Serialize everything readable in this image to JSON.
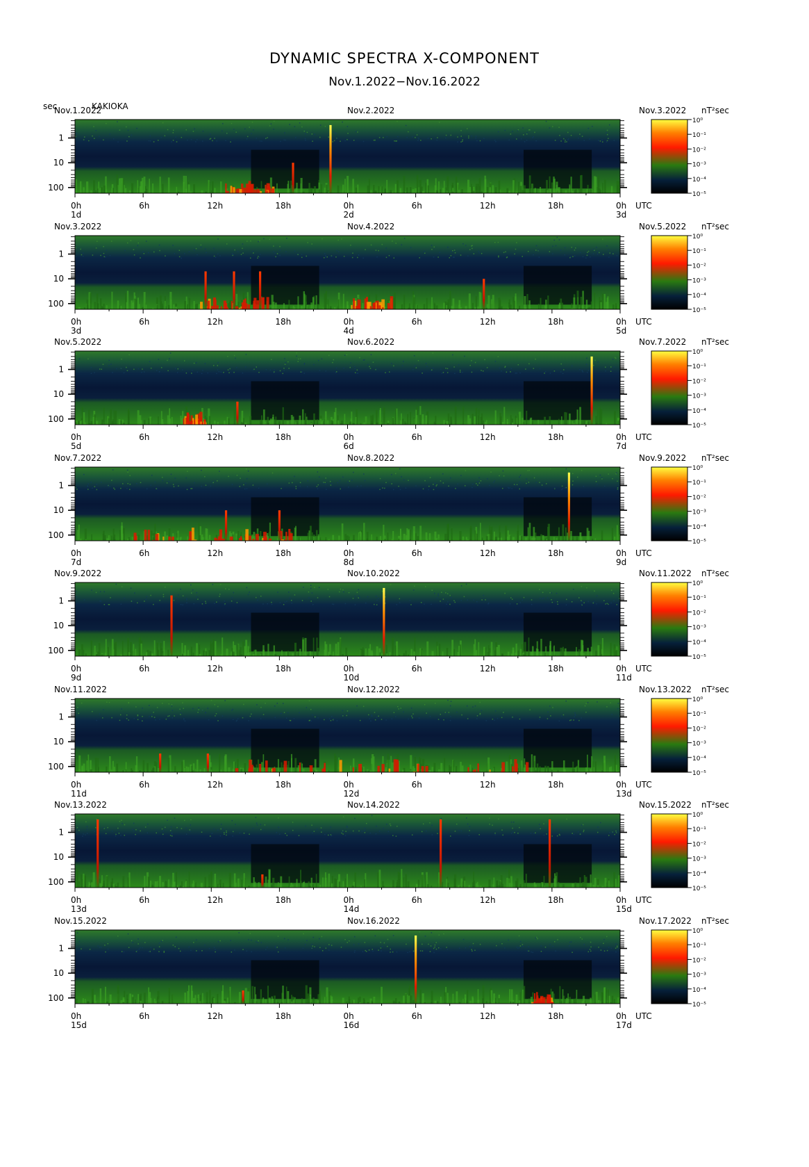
{
  "header": {
    "title": "DYNAMIC SPECTRA X-COMPONENT",
    "subtitle": "Nov.1.2022−Nov.16.2022",
    "y_unit": "sec",
    "station": "KAKIOKA"
  },
  "colorbar": {
    "unit": "nT²sec",
    "ticks": [
      "10⁰",
      "10⁻¹",
      "10⁻²",
      "10⁻³",
      "10⁻⁴",
      "10⁻⁵"
    ],
    "colors": [
      "#ffff40",
      "#ff8000",
      "#ff1a00",
      "#2a7a10",
      "#06203a",
      "#000000"
    ]
  },
  "chart_data": {
    "type": "heatmap",
    "title": "DYNAMIC SPECTRA X-COMPONENT",
    "subtitle": "Nov.1.2022−Nov.16.2022",
    "ylabel": "sec",
    "y_scale": "log",
    "y_ticks": [
      "1",
      "10",
      "100"
    ],
    "x_ticks": [
      "0h",
      "6h",
      "12h",
      "18h",
      "0h",
      "6h",
      "12h",
      "18h",
      "0h"
    ],
    "x_end_label": "UTC",
    "colorbar_range": [
      "10⁻⁵",
      "10⁰"
    ],
    "panels": [
      {
        "left_date": "Nov.1.2022",
        "mid_date": "Nov.2.2022",
        "right_date": "Nov.3.2022",
        "day_labels": [
          "1d",
          "2d",
          "3d"
        ],
        "events": [
          {
            "hour": 22.5,
            "top_sec": 0.3,
            "peak": "yellow"
          },
          {
            "hour": 19.2,
            "top_sec": 10,
            "peak": "red"
          }
        ],
        "active": [
          {
            "from": 13.2,
            "to": 17.5,
            "level": "red"
          }
        ]
      },
      {
        "left_date": "Nov.3.2022",
        "mid_date": "Nov.4.2022",
        "right_date": "Nov.5.2022",
        "day_labels": [
          "3d",
          "4d",
          "5d"
        ],
        "events": [
          {
            "hour": 11.5,
            "top_sec": 5,
            "peak": "red"
          },
          {
            "hour": 14.0,
            "top_sec": 5,
            "peak": "red"
          },
          {
            "hour": 16.3,
            "top_sec": 5,
            "peak": "red"
          },
          {
            "hour": 36.0,
            "top_sec": 10,
            "peak": "red"
          }
        ],
        "active": [
          {
            "from": 11.0,
            "to": 17.0,
            "level": "red"
          },
          {
            "from": 24.0,
            "to": 28.0,
            "level": "red"
          }
        ]
      },
      {
        "left_date": "Nov.5.2022",
        "mid_date": "Nov.6.2022",
        "right_date": "Nov.7.2022",
        "day_labels": [
          "5d",
          "6d",
          "7d"
        ],
        "events": [
          {
            "hour": 45.5,
            "top_sec": 0.3,
            "peak": "yellow"
          },
          {
            "hour": 14.3,
            "top_sec": 20,
            "peak": "red"
          }
        ],
        "active": [
          {
            "from": 9.5,
            "to": 11.5,
            "level": "red"
          }
        ]
      },
      {
        "left_date": "Nov.7.2022",
        "mid_date": "Nov.8.2022",
        "right_date": "Nov.9.2022",
        "day_labels": [
          "7d",
          "8d",
          "9d"
        ],
        "events": [
          {
            "hour": 43.5,
            "top_sec": 0.3,
            "peak": "yellow"
          },
          {
            "hour": 13.3,
            "top_sec": 10,
            "peak": "red"
          },
          {
            "hour": 18.0,
            "top_sec": 10,
            "peak": "red"
          }
        ],
        "active": [
          {
            "from": 5.0,
            "to": 19.0,
            "level": "red"
          }
        ]
      },
      {
        "left_date": "Nov.9.2022",
        "mid_date": "Nov.10.2022",
        "right_date": "Nov.11.2022",
        "day_labels": [
          "9d",
          "10d",
          "11d"
        ],
        "events": [
          {
            "hour": 27.2,
            "top_sec": 0.3,
            "peak": "yellow"
          },
          {
            "hour": 8.5,
            "top_sec": 0.6,
            "peak": "red"
          }
        ],
        "active": []
      },
      {
        "left_date": "Nov.11.2022",
        "mid_date": "Nov.12.2022",
        "right_date": "Nov.13.2022",
        "day_labels": [
          "11d",
          "12d",
          "13d"
        ],
        "events": [
          {
            "hour": 7.5,
            "top_sec": 30,
            "peak": "red"
          },
          {
            "hour": 11.7,
            "top_sec": 30,
            "peak": "red"
          }
        ],
        "active": [
          {
            "from": 14.0,
            "to": 40.0,
            "level": "red"
          }
        ]
      },
      {
        "left_date": "Nov.13.2022",
        "mid_date": "Nov.14.2022",
        "right_date": "Nov.15.2022",
        "day_labels": [
          "13d",
          "14d",
          "15d"
        ],
        "events": [
          {
            "hour": 2.0,
            "top_sec": 0.3,
            "peak": "red"
          },
          {
            "hour": 32.2,
            "top_sec": 0.3,
            "peak": "red"
          },
          {
            "hour": 41.8,
            "top_sec": 0.3,
            "peak": "red"
          },
          {
            "hour": 16.5,
            "top_sec": 50,
            "peak": "red"
          }
        ],
        "active": []
      },
      {
        "left_date": "Nov.15.2022",
        "mid_date": "Nov.16.2022",
        "right_date": "Nov.17.2022",
        "day_labels": [
          "15d",
          "16d",
          "17d"
        ],
        "events": [
          {
            "hour": 30.0,
            "top_sec": 0.3,
            "peak": "yellow"
          },
          {
            "hour": 14.8,
            "top_sec": 50,
            "peak": "red"
          }
        ],
        "active": [
          {
            "from": 40.0,
            "to": 42.0,
            "level": "red"
          }
        ]
      }
    ]
  }
}
